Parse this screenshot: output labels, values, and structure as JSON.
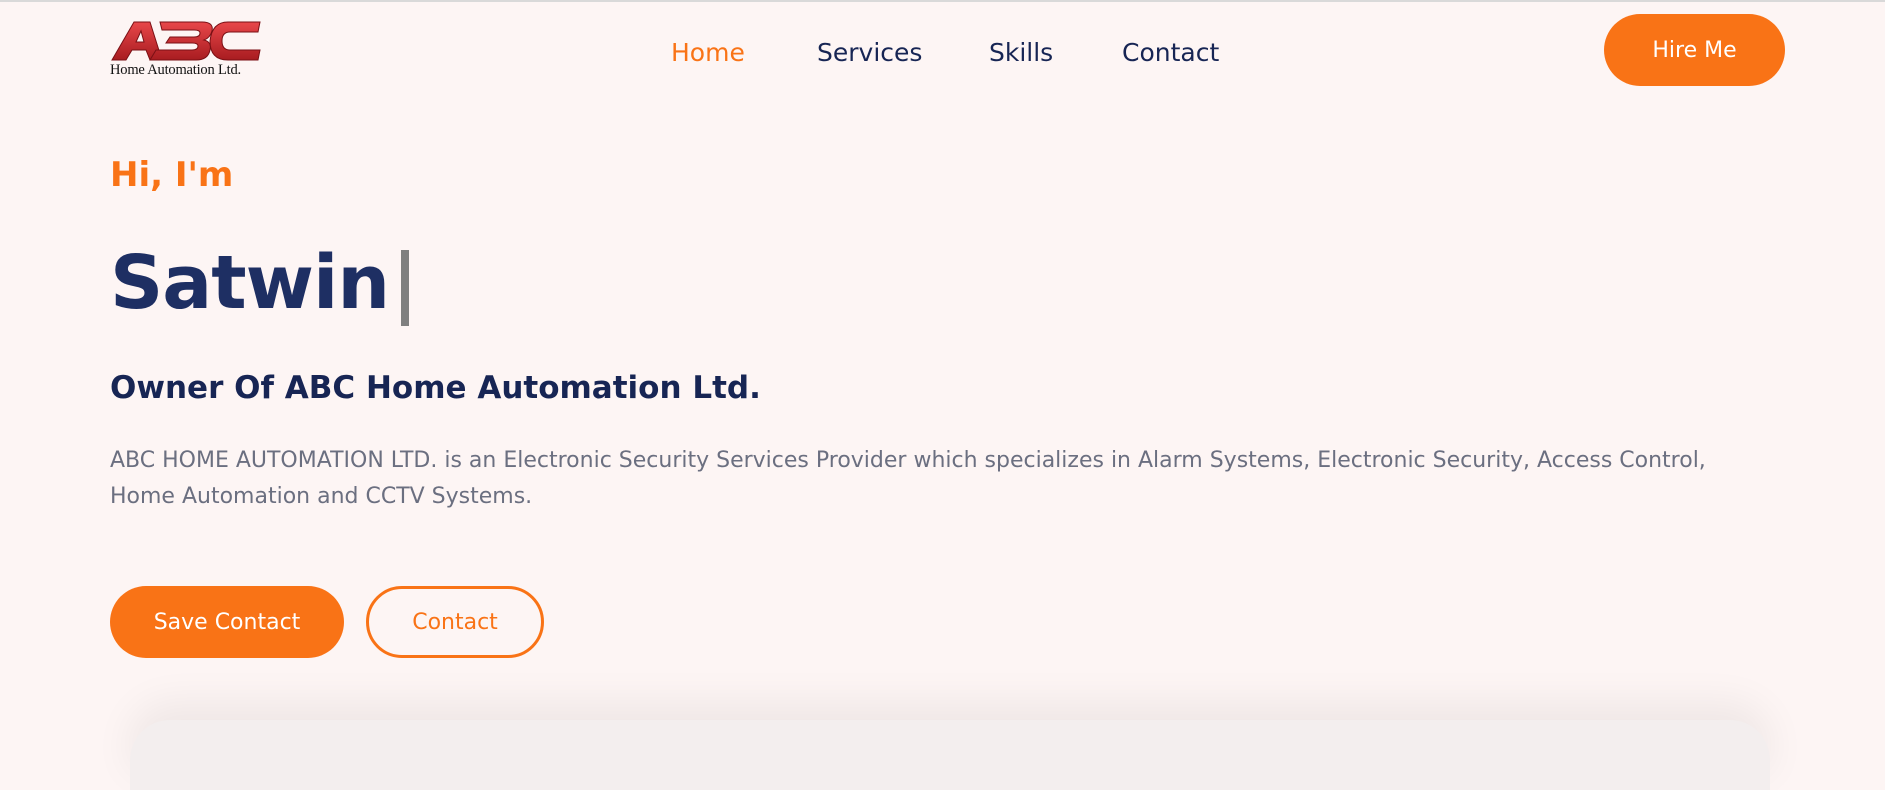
{
  "header": {
    "logo": {
      "mark": "ABC",
      "tagline": "Home Automation Ltd."
    },
    "nav": [
      {
        "label": "Home",
        "active": true
      },
      {
        "label": "Services",
        "active": false
      },
      {
        "label": "Skills",
        "active": false
      },
      {
        "label": "Contact",
        "active": false
      }
    ],
    "hire_label": "Hire Me"
  },
  "hero": {
    "greeting": "Hi, I'm",
    "name": "Satwin",
    "role": "Owner Of ABC Home Automation Ltd.",
    "description": "ABC HOME AUTOMATION LTD. is an Electronic Security Services Provider which specializes in Alarm Systems, Electronic Security, Access Control, Home Automation and CCTV Systems.",
    "primary_button": "Save Contact",
    "secondary_button": "Contact"
  },
  "colors": {
    "accent": "#f97316",
    "heading": "#172554",
    "body_text": "#6b6f80",
    "background": "#fdf5f4",
    "logo_red": "#d42b2b"
  }
}
